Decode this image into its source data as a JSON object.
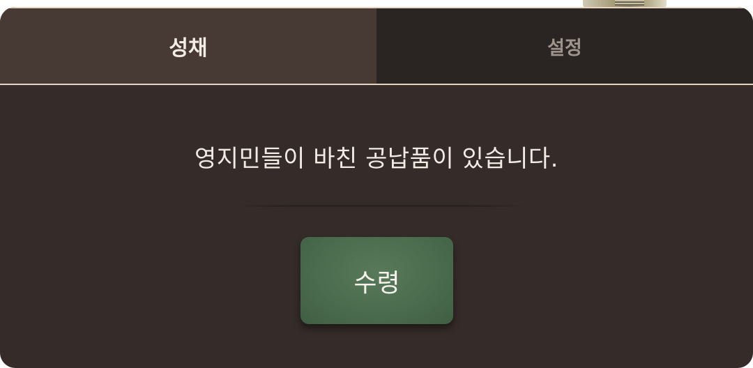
{
  "tabs": [
    {
      "label": "성채",
      "active": true
    },
    {
      "label": "설정",
      "active": false
    }
  ],
  "message": "영지민들이 바친 공납품이 있습니다.",
  "claim_button": {
    "label": "수령"
  },
  "colors": {
    "panel_bg": "#352b29",
    "active_tab_bg": "#473a35",
    "inactive_tab_bg": "#2a2523",
    "tab_border": "#e6d3c0",
    "button_green": "#4c6c4f",
    "text_light": "#f2ebe4",
    "text_muted": "#9f948c"
  }
}
